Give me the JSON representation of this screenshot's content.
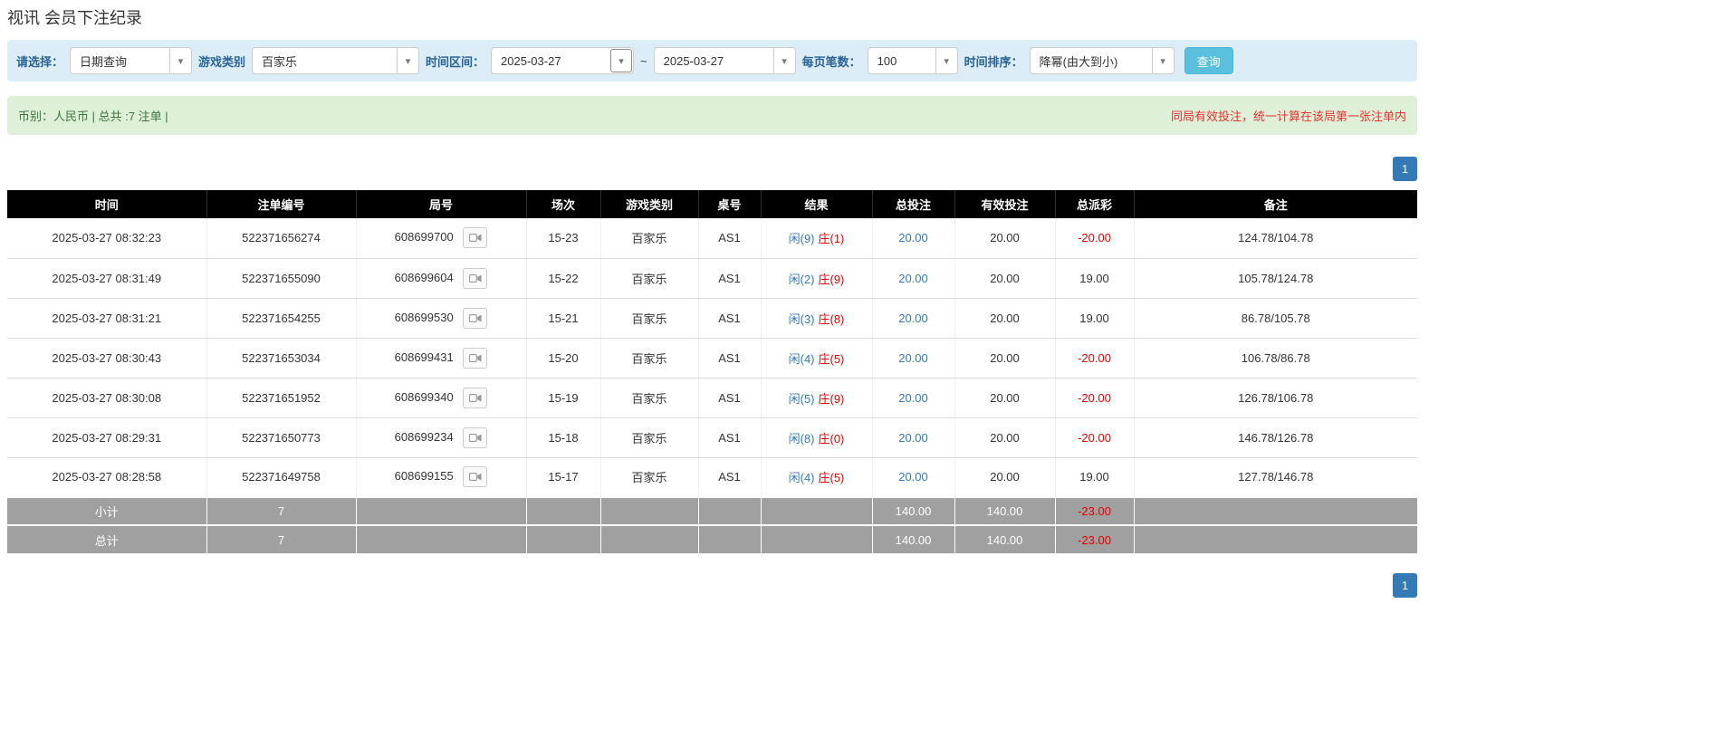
{
  "page": {
    "title": "视讯 会员下注纪录"
  },
  "filters": {
    "select_label": "请选择：",
    "select_value": "日期查询",
    "game_type_label": "游戏类别",
    "game_type_value": "百家乐",
    "time_range_label": "时间区间：",
    "date_from": "2025-03-27",
    "range_separator": "~",
    "date_to": "2025-03-27",
    "page_size_label": "每页笔数：",
    "page_size_value": "100",
    "sort_label": "时间排序：",
    "sort_value": "降幂(由大到小)",
    "search_button": "查询"
  },
  "summary": {
    "left": "币别：人民币 | 总共 :7 注单 |",
    "right": "同局有效投注，统一计算在该局第一张注单内"
  },
  "pagination": {
    "page": "1"
  },
  "table": {
    "headers": [
      "时间",
      "注单编号",
      "局号",
      "场次",
      "游戏类别",
      "桌号",
      "结果",
      "总投注",
      "有效投注",
      "总派彩",
      "备注"
    ],
    "rows": [
      {
        "time": "2025-03-27 08:32:23",
        "bet_id": "522371656274",
        "round_id": "608699700",
        "session": "15-23",
        "game": "百家乐",
        "table_no": "AS1",
        "result_player": "闲(9)",
        "result_banker": "庄(1)",
        "total_bet": "20.00",
        "valid_bet": "20.00",
        "payout": "-20.00",
        "remark": "124.78/104.78"
      },
      {
        "time": "2025-03-27 08:31:49",
        "bet_id": "522371655090",
        "round_id": "608699604",
        "session": "15-22",
        "game": "百家乐",
        "table_no": "AS1",
        "result_player": "闲(2)",
        "result_banker": "庄(9)",
        "total_bet": "20.00",
        "valid_bet": "20.00",
        "payout": "19.00",
        "remark": "105.78/124.78"
      },
      {
        "time": "2025-03-27 08:31:21",
        "bet_id": "522371654255",
        "round_id": "608699530",
        "session": "15-21",
        "game": "百家乐",
        "table_no": "AS1",
        "result_player": "闲(3)",
        "result_banker": "庄(8)",
        "total_bet": "20.00",
        "valid_bet": "20.00",
        "payout": "19.00",
        "remark": "86.78/105.78"
      },
      {
        "time": "2025-03-27 08:30:43",
        "bet_id": "522371653034",
        "round_id": "608699431",
        "session": "15-20",
        "game": "百家乐",
        "table_no": "AS1",
        "result_player": "闲(4)",
        "result_banker": "庄(5)",
        "total_bet": "20.00",
        "valid_bet": "20.00",
        "payout": "-20.00",
        "remark": "106.78/86.78"
      },
      {
        "time": "2025-03-27 08:30:08",
        "bet_id": "522371651952",
        "round_id": "608699340",
        "session": "15-19",
        "game": "百家乐",
        "table_no": "AS1",
        "result_player": "闲(5)",
        "result_banker": "庄(9)",
        "total_bet": "20.00",
        "valid_bet": "20.00",
        "payout": "-20.00",
        "remark": "126.78/106.78"
      },
      {
        "time": "2025-03-27 08:29:31",
        "bet_id": "522371650773",
        "round_id": "608699234",
        "session": "15-18",
        "game": "百家乐",
        "table_no": "AS1",
        "result_player": "闲(8)",
        "result_banker": "庄(0)",
        "total_bet": "20.00",
        "valid_bet": "20.00",
        "payout": "-20.00",
        "remark": "146.78/126.78"
      },
      {
        "time": "2025-03-27 08:28:58",
        "bet_id": "522371649758",
        "round_id": "608699155",
        "session": "15-17",
        "game": "百家乐",
        "table_no": "AS1",
        "result_player": "闲(4)",
        "result_banker": "庄(5)",
        "total_bet": "20.00",
        "valid_bet": "20.00",
        "payout": "19.00",
        "remark": "127.78/146.78"
      }
    ],
    "subtotal": {
      "label": "小计",
      "count": "7",
      "total_bet": "140.00",
      "valid_bet": "140.00",
      "payout": "-23.00"
    },
    "total": {
      "label": "总计",
      "count": "7",
      "total_bet": "140.00",
      "valid_bet": "140.00",
      "payout": "-23.00"
    }
  }
}
